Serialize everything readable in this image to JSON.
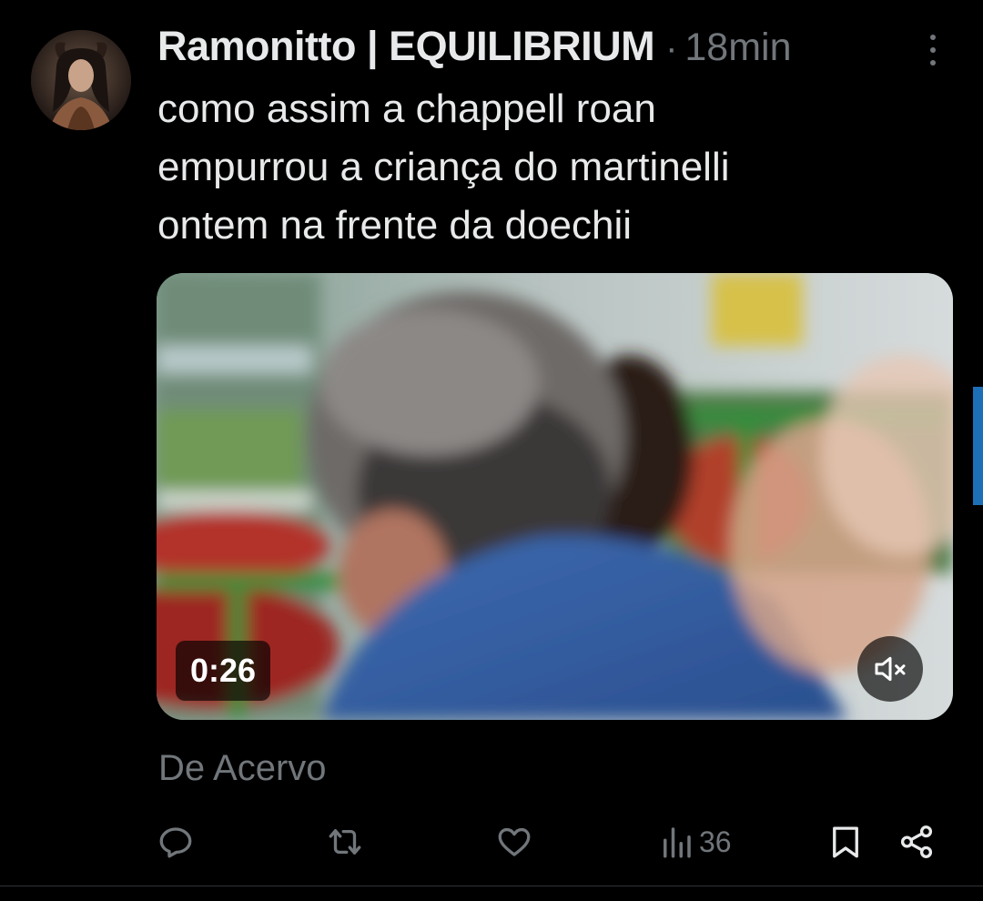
{
  "post": {
    "author": {
      "display_name": "Ramonitto | EQUILIBRIUM",
      "avatar_icon": "profile-avatar"
    },
    "separator": "·",
    "timestamp": "18min",
    "text_lines": [
      "como assim a chappell roan",
      "empurrou a criança do martinelli",
      "ontem na frente da doechii"
    ],
    "media": {
      "type": "video",
      "duration": "0:26",
      "muted": true,
      "mute_icon": "speaker-muted-icon"
    },
    "source_label": "De Acervo"
  },
  "actions": {
    "reply_icon": "reply-icon",
    "repost_icon": "repost-icon",
    "like_icon": "heart-icon",
    "views_icon": "views-icon",
    "views_count": "36",
    "bookmark_icon": "bookmark-icon",
    "share_icon": "share-icon"
  },
  "colors": {
    "background": "#000000",
    "text_primary": "#e7e9ea",
    "text_secondary": "#71767b",
    "accent_scroll": "#1d6fb8"
  }
}
